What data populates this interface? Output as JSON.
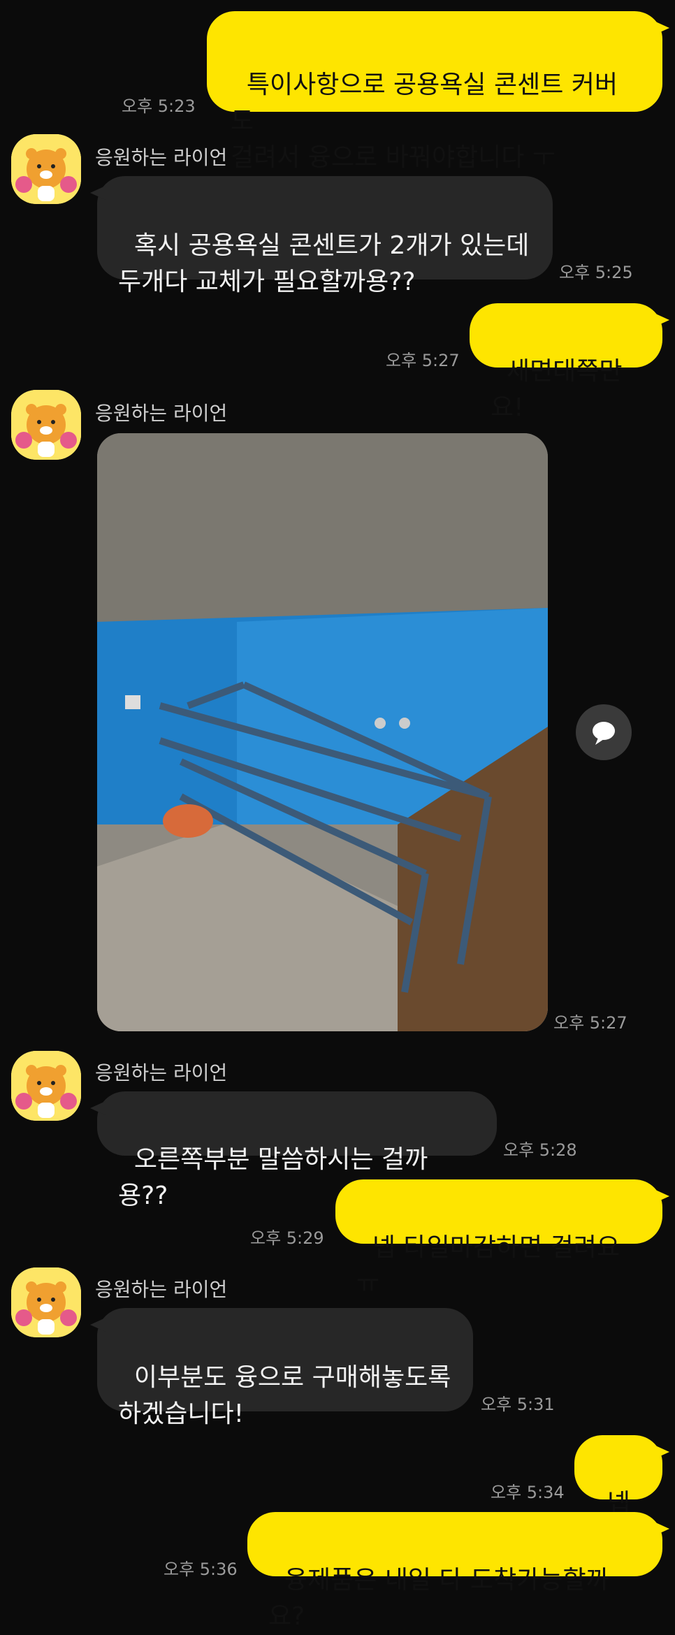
{
  "contact": {
    "name": "응원하는 라이언",
    "avatar_icon": "lion-character-icon"
  },
  "colors": {
    "background": "#0b0b0b",
    "my_bubble": "#fee500",
    "other_bubble": "#272727",
    "time": "#9a9a9a"
  },
  "messages": [
    {
      "from": "me",
      "text": "특이사항으로 공용욕실 콘센트 커버도\n걸려서 융으로 바꿔야합니다 ㅜ",
      "time": "오후 5:23"
    },
    {
      "from": "other",
      "text": "혹시 공용욕실 콘센트가 2개가 있는데\n두개다 교체가 필요할까용??",
      "time": "오후 5:25"
    },
    {
      "from": "me",
      "text": "세면대쪽만요!",
      "time": "오후 5:27"
    },
    {
      "from": "other",
      "type": "photo",
      "time": "오후 5:27"
    },
    {
      "from": "other",
      "text": "오른쪽부분 말씀하시는 걸까용??",
      "time": "오후 5:28"
    },
    {
      "from": "me",
      "text": "넵 타일마감하면 걸려요 ㅠ",
      "time": "오후 5:29"
    },
    {
      "from": "other",
      "text": "이부분도 융으로 구매해놓도록\n하겠습니다!",
      "time": "오후 5:31"
    },
    {
      "from": "me",
      "text": "넵넵",
      "time": "오후 5:34"
    },
    {
      "from": "me",
      "text": "융제품은 내일 다 도착가능할까요?",
      "time": "오후 5:36"
    }
  ],
  "share_icon": "chat-bubble-share-icon"
}
